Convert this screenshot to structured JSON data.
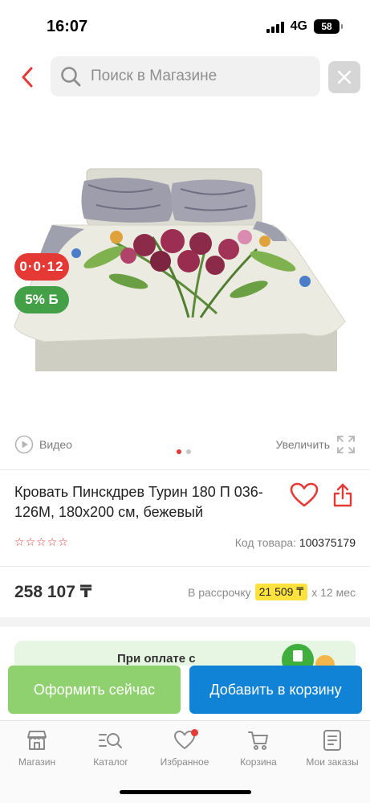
{
  "status": {
    "time": "16:07",
    "network": "4G",
    "battery": "58"
  },
  "search": {
    "placeholder": "Поиск в Магазине"
  },
  "badges": {
    "timer": "0·0·12",
    "bonus": "5% Б"
  },
  "media": {
    "video_label": "Видео",
    "zoom_label": "Увеличить",
    "slides": 2,
    "active_slide": 1
  },
  "product": {
    "title": "Кровать Пинскдрев Турин 180 П 036-126М, 180х200 см, бежевый",
    "rating": 0,
    "code_label": "Код товара:",
    "code_value": "100375179",
    "price": "258 107 ₸",
    "installment_prefix": "В рассрочку",
    "installment_amount": "21 509 ₸",
    "installment_suffix": "х 12 мес"
  },
  "promo": {
    "text": "При оплате с"
  },
  "actions": {
    "buy_now": "Оформить сейчас",
    "add_to_cart": "Добавить в корзину"
  },
  "nav": {
    "shop": "Магазин",
    "catalog": "Каталог",
    "favorites": "Избранное",
    "cart": "Корзина",
    "orders": "Мои заказы"
  },
  "colors": {
    "accent_red": "#e53935",
    "buy_green": "#8fd16e",
    "cart_blue": "#1183d6",
    "highlight_yellow": "#ffe23d"
  }
}
